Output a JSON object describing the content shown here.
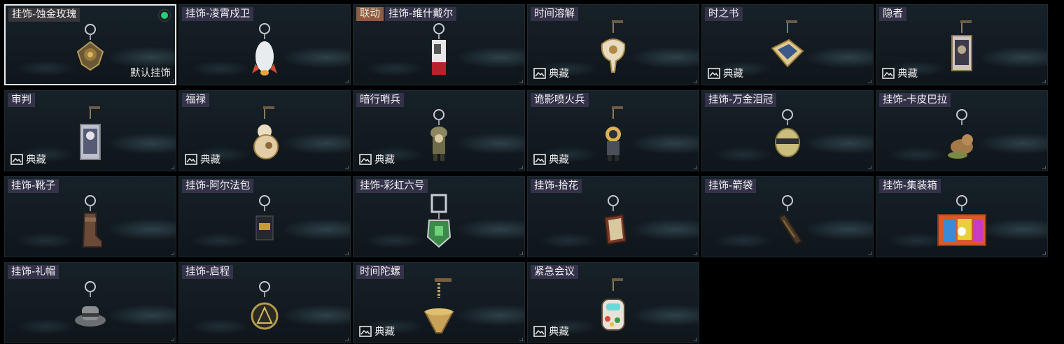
{
  "items": [
    {
      "name": "挂饰-蚀金玫瑰",
      "collab": "",
      "badge": "",
      "default_label": "默认挂饰",
      "selected": true,
      "equipped": true,
      "charm": "rose"
    },
    {
      "name": "挂饰-凌霄戍卫",
      "collab": "",
      "badge": "",
      "default_label": "",
      "charm": "rocket"
    },
    {
      "name": "挂饰-维什戴尔",
      "collab": "联动",
      "badge": "",
      "default_label": "",
      "charm": "card"
    },
    {
      "name": "时间溶解",
      "collab": "",
      "badge": "典藏",
      "default_label": "",
      "charm": "clock"
    },
    {
      "name": "时之书",
      "collab": "",
      "badge": "典藏",
      "default_label": "",
      "charm": "book"
    },
    {
      "name": "隐者",
      "collab": "",
      "badge": "典藏",
      "default_label": "",
      "charm": "tarot"
    },
    {
      "name": "审判",
      "collab": "",
      "badge": "典藏",
      "default_label": "",
      "charm": "tarot2"
    },
    {
      "name": "福禄",
      "collab": "",
      "badge": "典藏",
      "default_label": "",
      "charm": "gourd"
    },
    {
      "name": "暗行哨兵",
      "collab": "",
      "badge": "典藏",
      "default_label": "",
      "charm": "soldier"
    },
    {
      "name": "诡影喷火兵",
      "collab": "",
      "badge": "典藏",
      "default_label": "",
      "charm": "diver"
    },
    {
      "name": "挂饰-万金泪冠",
      "collab": "",
      "badge": "",
      "default_label": "",
      "charm": "crown"
    },
    {
      "name": "挂饰-卡皮巴拉",
      "collab": "",
      "badge": "",
      "default_label": "",
      "charm": "capybara"
    },
    {
      "name": "挂饰-靴子",
      "collab": "",
      "badge": "",
      "default_label": "",
      "charm": "boot"
    },
    {
      "name": "挂饰-阿尔法包",
      "collab": "",
      "badge": "",
      "default_label": "",
      "charm": "bag"
    },
    {
      "name": "挂饰-彩虹六号",
      "collab": "",
      "badge": "",
      "default_label": "",
      "charm": "r6"
    },
    {
      "name": "挂饰-拾花",
      "collab": "",
      "badge": "",
      "default_label": "",
      "charm": "frame"
    },
    {
      "name": "挂饰-箭袋",
      "collab": "",
      "badge": "",
      "default_label": "",
      "charm": "quiver"
    },
    {
      "name": "挂饰-集装箱",
      "collab": "",
      "badge": "",
      "default_label": "",
      "charm": "container"
    },
    {
      "name": "挂饰-礼帽",
      "collab": "",
      "badge": "",
      "default_label": "",
      "charm": "hat"
    },
    {
      "name": "挂饰-启程",
      "collab": "",
      "badge": "",
      "default_label": "",
      "charm": "medal"
    },
    {
      "name": "时间陀螺",
      "collab": "",
      "badge": "典藏",
      "default_label": "",
      "charm": "top"
    },
    {
      "name": "紧急会议",
      "collab": "",
      "badge": "典藏",
      "default_label": "",
      "charm": "crewmate"
    }
  ],
  "colors": {
    "equipped": "#22d07a",
    "label_bg": "#3a3650",
    "collab_bg": "#8a5e42"
  }
}
